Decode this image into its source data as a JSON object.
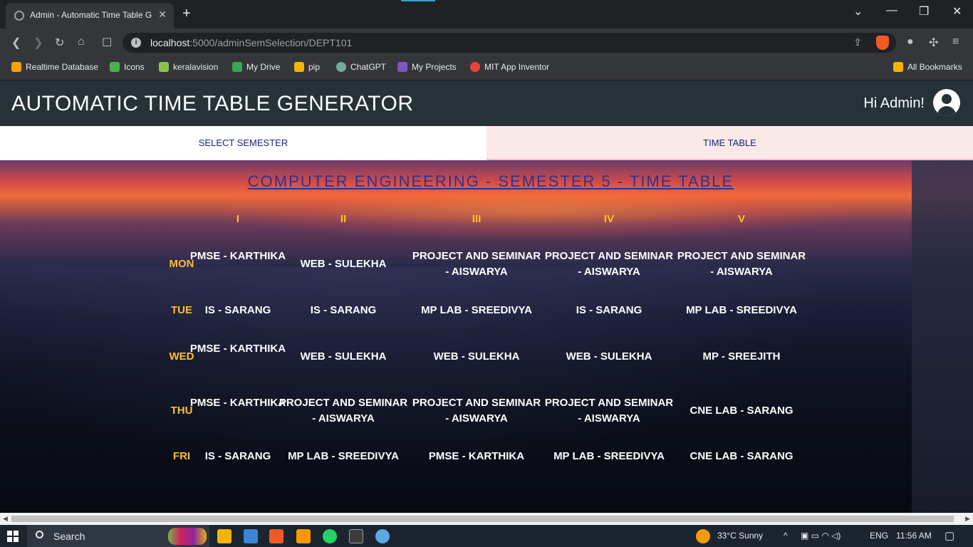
{
  "browser": {
    "tab_title": "Admin - Automatic Time Table G",
    "url_host": "localhost",
    "url_path": ":5000/adminSemSelection/DEPT101",
    "bookmarks": [
      {
        "label": "Realtime Database",
        "color": "#ffa000"
      },
      {
        "label": "Icons",
        "color": "#4caf50"
      },
      {
        "label": "keralavision",
        "color": "#8bc34a"
      },
      {
        "label": "My Drive",
        "color": "#34a853"
      },
      {
        "label": "pip",
        "color": "#f4b400"
      },
      {
        "label": "ChatGPT",
        "color": "#74aa9c"
      },
      {
        "label": "My Projects",
        "color": "#7e57c2"
      },
      {
        "label": "MIT App Inventor",
        "color": "#ea4335"
      }
    ],
    "all_bookmarks": "All Bookmarks"
  },
  "app": {
    "title": "AUTOMATIC TIME TABLE GENERATOR",
    "greeting": "Hi Admin!",
    "nav_tabs": [
      "SELECT SEMESTER",
      "TIME TABLE"
    ]
  },
  "timetable": {
    "title": "COMPUTER ENGINEERING - SEMESTER 5 - TIME TABLE",
    "periods": [
      "I",
      "II",
      "III",
      "IV",
      "V"
    ],
    "rows": [
      {
        "day": "MON",
        "cells": [
          "PMSE - KARTHIKA",
          "WEB - SULEKHA",
          "PROJECT AND SEMINAR - AISWARYA",
          "PROJECT AND SEMINAR - AISWARYA",
          "PROJECT AND SEMINAR - AISWARYA"
        ]
      },
      {
        "day": "TUE",
        "cells": [
          "IS - SARANG",
          "IS - SARANG",
          "MP LAB - SREEDIVYA",
          "IS - SARANG",
          "MP LAB - SREEDIVYA"
        ]
      },
      {
        "day": "WED",
        "cells": [
          "PMSE - KARTHIKA",
          "WEB - SULEKHA",
          "WEB - SULEKHA",
          "WEB - SULEKHA",
          "MP - SREEJITH"
        ]
      },
      {
        "day": "THU",
        "cells": [
          "PMSE - KARTHIKA",
          "PROJECT AND SEMINAR - AISWARYA",
          "PROJECT AND SEMINAR - AISWARYA",
          "PROJECT AND SEMINAR - AISWARYA",
          "CNE LAB - SARANG"
        ]
      },
      {
        "day": "FRI",
        "cells": [
          "IS - SARANG",
          "MP LAB - SREEDIVYA",
          "PMSE - KARTHIKA",
          "MP LAB - SREEDIVYA",
          "CNE LAB - SARANG"
        ]
      }
    ]
  },
  "taskbar": {
    "search_label": "Search",
    "weather": "33°C  Sunny",
    "language": "ENG",
    "time": "11:56 AM"
  }
}
